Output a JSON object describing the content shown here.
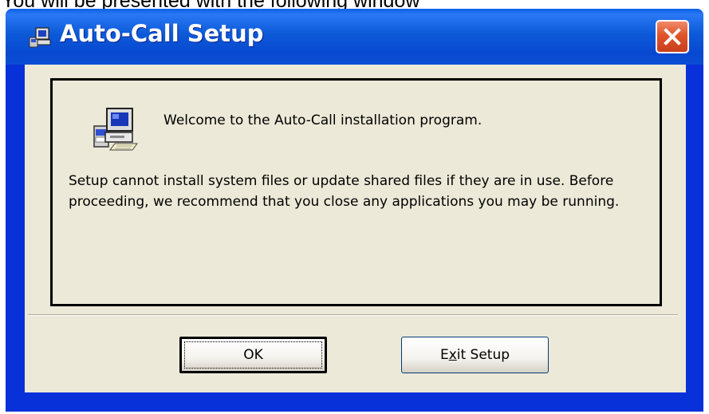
{
  "caption": "You will be presented with the following window",
  "window": {
    "title": "Auto-Call Setup",
    "close_icon": "close-icon"
  },
  "content": {
    "welcome": "Welcome to the Auto-Call installation program.",
    "body": "Setup cannot install system files or update shared files if they are in use. Before proceeding, we recommend that you close any applications you may be running.",
    "icon": "setup-computer-icon"
  },
  "buttons": {
    "ok_label": "OK",
    "exit_label_pre": "E",
    "exit_label_mnemonic": "x",
    "exit_label_post": "it Setup"
  },
  "colors": {
    "titlebar": "#0a5ee8",
    "client": "#ece9d8",
    "close": "#e0542a"
  }
}
